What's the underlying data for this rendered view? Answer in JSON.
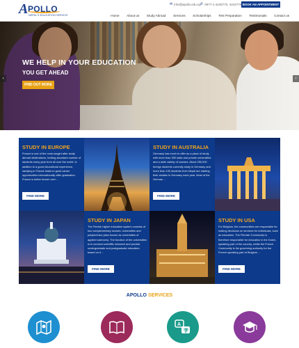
{
  "header": {
    "logo_letter": "A",
    "logo_word": "POLLO",
    "logo_tagline": "NEPAL'S EDUCATION SERVICE",
    "email": "info@apollo.edu.np",
    "phone": "0977-1-4245770, 4244770",
    "appointment_label": "BOOK AN APPOINTMENT",
    "nav": [
      "Home",
      "About us",
      "Study Abroad",
      "Services",
      "Scholarships",
      "Test Preparation",
      "Testimonials",
      "Contact us"
    ]
  },
  "hero": {
    "title": "WE HELP IN YOUR EDUCATION",
    "subtitle": "YOU GET AHEAD",
    "button_label": "FIND OUT MORE",
    "prev_arrow": "‹",
    "next_arrow": "›"
  },
  "destinations": [
    {
      "title": "STUDY IN EUROPE",
      "body": "France is one of the most sought after study abroad destinations, inviting abundant number of students every year from all over the world. In addition to a good educational experience, studying in France leads to good career opportunities internationally after graduation. France is better known over ...",
      "button": "FIND MORE"
    },
    {
      "title": "STUDY IN AUSTRALIA",
      "body": "Germany has much to offer as a place of study with more than 300 state and private universities and a wide variety of courses. About 250,000 foreign students currently study in Germany and more than 100 students from Nepal are starting their studies in Germany each year. Most of the German ...",
      "button": "FIND MORE"
    },
    {
      "title": "STUDY IN JAPAN",
      "body": "The Finnish higher education system consists of two complementary sectors: universities and polytechnics (also known as universities of applied sciences). The function of the universities is to conduct scientific research and provide undergraduate and postgraduate education based on it ...",
      "button": "FIND MORE"
    },
    {
      "title": "STUDY IN USA",
      "body": "For Belgium, the communities are responsible for making decisions on services for individuals, such as education. The Flemish Community is therefore responsible for education in the Dutch-speaking part of the country, whilst the French Community is the governing authority for the French speaking part of Belgium ...",
      "button": "FIND MORE"
    }
  ],
  "services": {
    "title_a": "APOLLO",
    "title_b": "SERVICES",
    "items": [
      {
        "icon": "map-icon",
        "color": "#1e8fd0"
      },
      {
        "icon": "book-icon",
        "color": "#9c2a5a"
      },
      {
        "icon": "translation-icon",
        "color": "#1a9a8a"
      },
      {
        "icon": "graduation-icon",
        "color": "#8a3a9a"
      }
    ]
  },
  "colors": {
    "brand_blue": "#0d3a8a",
    "accent_orange": "#e8a215"
  }
}
